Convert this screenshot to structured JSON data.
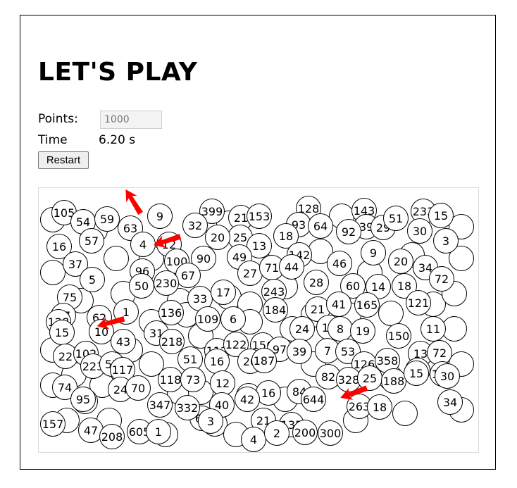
{
  "title": "LET'S PLAY",
  "points_label": "Points:",
  "points_value": "1000",
  "time_label": "Time",
  "time_value": "6.20 s",
  "restart_label": "Restart",
  "arrow_color": "#ff0000",
  "circles": [
    "105",
    "54",
    "59",
    "63",
    "9",
    "399",
    "21",
    "153",
    "128",
    "93",
    "64",
    "143",
    "39",
    "29",
    "51",
    "233",
    "30",
    "15",
    "32",
    "25",
    "13",
    "92",
    "18",
    "20",
    "16",
    "57",
    "4",
    "12",
    "90",
    "49",
    "142",
    "46",
    "9",
    "20",
    "34",
    "3",
    "37",
    "5",
    "96",
    "100",
    "67",
    "27",
    "71",
    "44",
    "28",
    "60",
    "14",
    "18",
    "72",
    "75",
    "50",
    "230",
    "33",
    "17",
    "243",
    "21",
    "41",
    "165",
    "121",
    "47",
    "128",
    "62",
    "1",
    "136",
    "109",
    "6",
    "184",
    "24",
    "14",
    "8",
    "19",
    "150",
    "11",
    "15",
    "10",
    "43",
    "31",
    "218",
    "112",
    "122",
    "156",
    "97",
    "39",
    "7",
    "53",
    "13",
    "72",
    "22",
    "102",
    "223",
    "55",
    "117",
    "51",
    "16",
    "20",
    "187",
    "126",
    "358",
    "280",
    "146",
    "74",
    "35",
    "24",
    "70",
    "118",
    "73",
    "12",
    "94",
    "16",
    "84",
    "82",
    "328",
    "25",
    "188",
    "15",
    "30",
    "95",
    "347",
    "40",
    "66",
    "332",
    "42",
    "21",
    "135",
    "644",
    "263",
    "18",
    "34",
    "157",
    "47",
    "208",
    "605",
    "1",
    "3",
    "4",
    "2",
    "200",
    "300"
  ]
}
